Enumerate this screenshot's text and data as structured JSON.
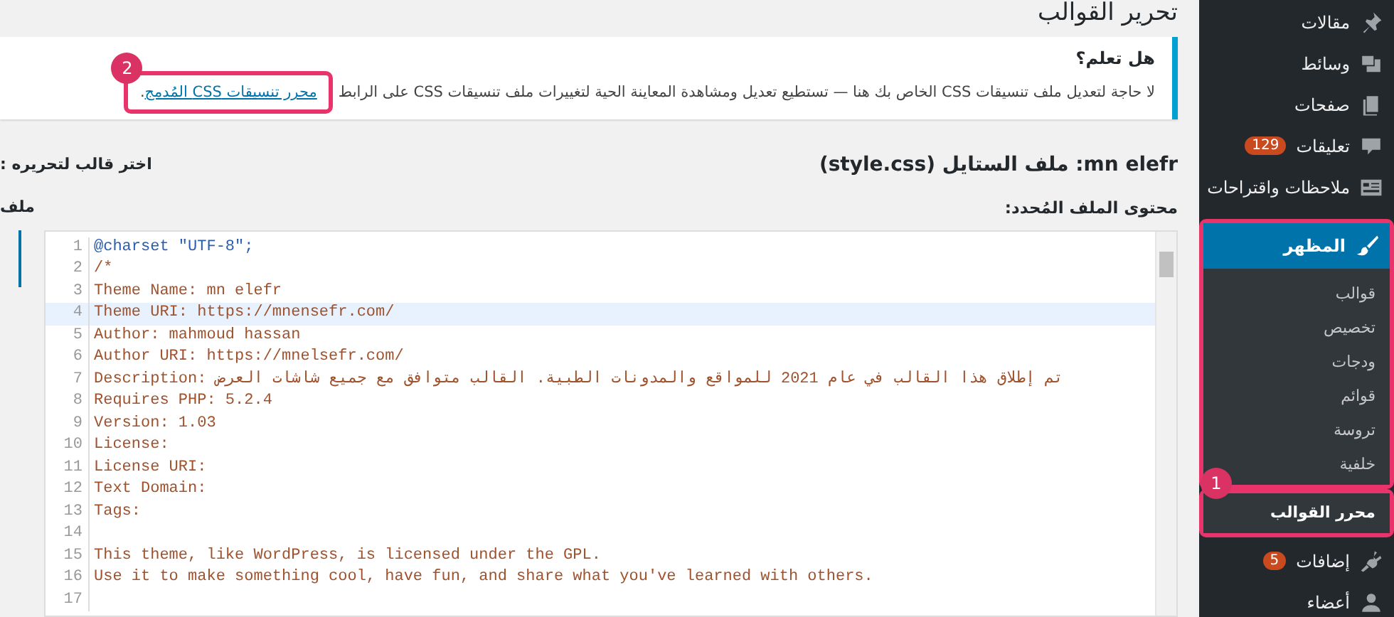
{
  "page_title": "تحرير القوالب",
  "notice": {
    "heading": "هل تعلم؟",
    "text": "لا حاجة لتعديل ملف تنسيقات CSS الخاص بك هنا — تستطيع تعديل ومشاهدة المعاينة الحية لتغييرات ملف تنسيقات CSS على الرابط",
    "link": "محرر تنسيقات CSS المُدمج",
    "end": "."
  },
  "theme_heading": "mn elefr: ملف الستايل (style.css)",
  "theme_select_label": "اختر قالب لتحريره :",
  "content_label": "محتوى الملف المُحدد:",
  "file_list_label": "ملف",
  "editor": {
    "lines": [
      {
        "number": "1",
        "highlighted": false,
        "segments": [
          {
            "kind": "keyword",
            "text": "@charset \"UTF-8\";"
          }
        ]
      },
      {
        "number": "2",
        "highlighted": false,
        "segments": [
          {
            "kind": "comment",
            "text": "/*"
          }
        ]
      },
      {
        "number": "3",
        "highlighted": false,
        "segments": [
          {
            "kind": "comment",
            "text": "Theme Name: mn elefr"
          }
        ]
      },
      {
        "number": "4",
        "highlighted": true,
        "segments": [
          {
            "kind": "comment",
            "text": "Theme URI: https://mnensefr.com/"
          }
        ]
      },
      {
        "number": "5",
        "highlighted": false,
        "segments": [
          {
            "kind": "comment",
            "text": "Author: mahmoud hassan"
          }
        ]
      },
      {
        "number": "6",
        "highlighted": false,
        "segments": [
          {
            "kind": "comment",
            "text": "Author URI: https://mnelsefr.com/"
          }
        ]
      },
      {
        "number": "7",
        "highlighted": false,
        "segments": [
          {
            "kind": "comment",
            "text": "Description: تم إطلاق هذا القالب في عام 2021 للمواقع والمدونات الطبية. القالب متوافق مع جميع شاشات العرض"
          }
        ]
      },
      {
        "number": "8",
        "highlighted": false,
        "segments": [
          {
            "kind": "comment",
            "text": "Requires PHP: 5.2.4"
          }
        ]
      },
      {
        "number": "9",
        "highlighted": false,
        "segments": [
          {
            "kind": "comment",
            "text": "Version: 1.03"
          }
        ]
      },
      {
        "number": "10",
        "highlighted": false,
        "segments": [
          {
            "kind": "comment",
            "text": "License:"
          }
        ]
      },
      {
        "number": "11",
        "highlighted": false,
        "segments": [
          {
            "kind": "comment",
            "text": "License URI:"
          }
        ]
      },
      {
        "number": "12",
        "highlighted": false,
        "segments": [
          {
            "kind": "comment",
            "text": "Text Domain:"
          }
        ]
      },
      {
        "number": "13",
        "highlighted": false,
        "segments": [
          {
            "kind": "comment",
            "text": "Tags:"
          }
        ]
      },
      {
        "number": "14",
        "highlighted": false
      },
      {
        "number": "15",
        "highlighted": false,
        "segments": [
          {
            "kind": "comment",
            "text": "This theme, like WordPress, is licensed under the GPL."
          }
        ]
      },
      {
        "number": "16",
        "highlighted": false,
        "segments": [
          {
            "kind": "comment",
            "text": "Use it to make something cool, have fun, and share what you've learned with others."
          }
        ]
      },
      {
        "number": "17",
        "highlighted": false
      }
    ]
  },
  "sidebar": {
    "items": [
      {
        "label": "مقالات",
        "kind": "pin",
        "selected": false
      },
      {
        "label": "وسائط",
        "kind": "media",
        "selected": false
      },
      {
        "label": "صفحات",
        "kind": "page",
        "selected": false
      },
      {
        "label": "تعليقات",
        "kind": "comment",
        "badge": "129",
        "selected": false
      },
      {
        "label": "ملاحظات واقتراحات",
        "kind": "feedback",
        "selected": false
      },
      {
        "label": "المظهر",
        "kind": "brush",
        "selected": true,
        "children": [
          {
            "label": "قوالب",
            "selected": false
          },
          {
            "label": "تخصيص",
            "selected": false
          },
          {
            "label": "ودجات",
            "selected": false
          },
          {
            "label": "قوائم",
            "selected": false
          },
          {
            "label": "تروسة",
            "selected": false
          },
          {
            "label": "خلفية",
            "selected": false
          },
          {
            "label": "محرر القوالب",
            "selected": true
          }
        ]
      },
      {
        "label": "إضافات",
        "kind": "plugin",
        "badge": "5",
        "selected": false
      },
      {
        "label": "أعضاء",
        "kind": "user",
        "selected": false
      }
    ]
  },
  "annotations": [
    {
      "number": "2"
    },
    {
      "number": "1"
    }
  ]
}
